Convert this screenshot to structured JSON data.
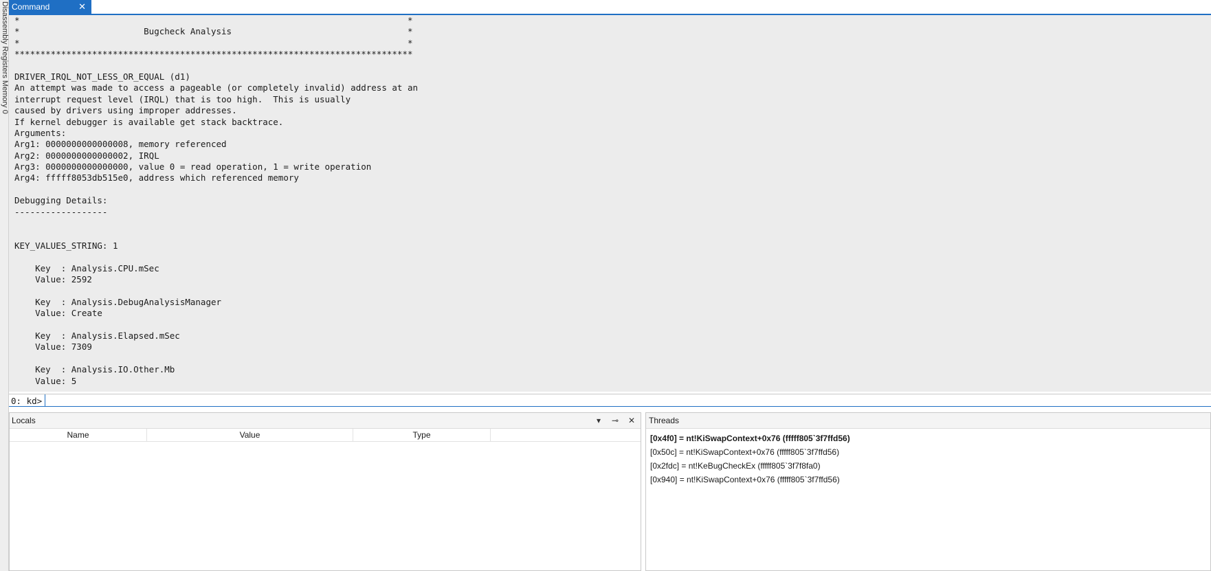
{
  "side_strip": {
    "text": "Disassembly  Registers  Memory 0"
  },
  "command_tab": {
    "title": "Command",
    "close_glyph": "✕"
  },
  "output_lines": [
    "*                                                                           *",
    "*                        Bugcheck Analysis                                  *",
    "*                                                                           *",
    "*****************************************************************************",
    "",
    "DRIVER_IRQL_NOT_LESS_OR_EQUAL (d1)",
    "An attempt was made to access a pageable (or completely invalid) address at an",
    "interrupt request level (IRQL) that is too high.  This is usually",
    "caused by drivers using improper addresses.",
    "If kernel debugger is available get stack backtrace.",
    "Arguments:",
    "Arg1: 0000000000000008, memory referenced",
    "Arg2: 0000000000000002, IRQL",
    "Arg3: 0000000000000000, value 0 = read operation, 1 = write operation",
    "Arg4: fffff8053db515e0, address which referenced memory",
    "",
    "Debugging Details:",
    "------------------",
    "",
    "",
    "KEY_VALUES_STRING: 1",
    "",
    "    Key  : Analysis.CPU.mSec",
    "    Value: 2592",
    "",
    "    Key  : Analysis.DebugAnalysisManager",
    "    Value: Create",
    "",
    "    Key  : Analysis.Elapsed.mSec",
    "    Value: 7309",
    "",
    "    Key  : Analysis.IO.Other.Mb",
    "    Value: 5"
  ],
  "prompt": {
    "label": "0: kd>",
    "value": ""
  },
  "locals": {
    "title": "Locals",
    "dropdown_glyph": "▾",
    "pin_glyph": "⊸",
    "close_glyph": "✕",
    "columns": [
      "Name",
      "Value",
      "Type"
    ]
  },
  "threads": {
    "title": "Threads",
    "items": [
      "[0x4f0] = nt!KiSwapContext+0x76 (fffff805`3f7ffd56)",
      "[0x50c] = nt!KiSwapContext+0x76 (fffff805`3f7ffd56)",
      "[0x2fdc] = nt!KeBugCheckEx (fffff805`3f7f8fa0)",
      "[0x940] = nt!KiSwapContext+0x76 (fffff805`3f7ffd56)"
    ]
  }
}
